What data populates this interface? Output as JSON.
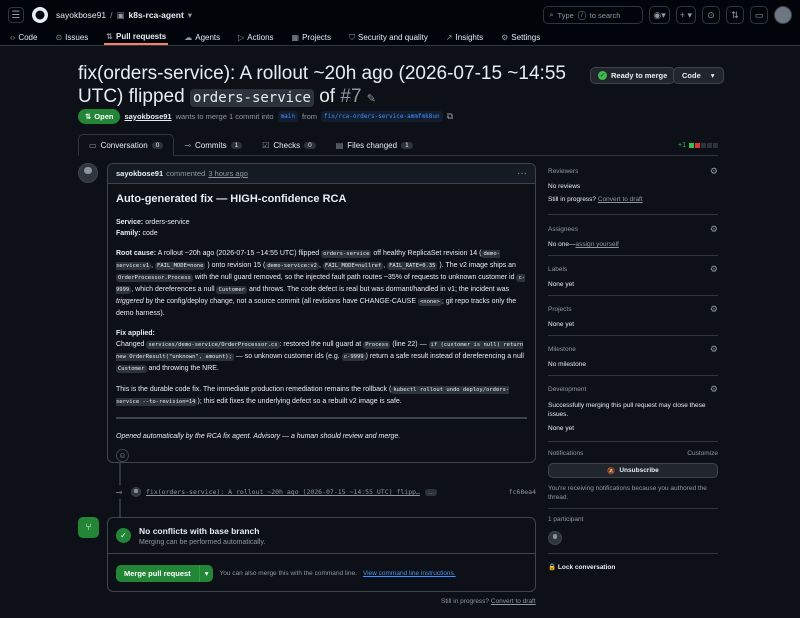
{
  "header": {
    "owner": "sayokbose91",
    "repo": "k8s-rca-agent",
    "search_placeholder": "Type / to search",
    "search_key": "/"
  },
  "nav_tabs": [
    {
      "label": "Code",
      "icon": "code-icon"
    },
    {
      "label": "Issues",
      "icon": "issue-icon"
    },
    {
      "label": "Pull requests",
      "icon": "pull-request-icon",
      "active": true
    },
    {
      "label": "Agents",
      "icon": "agent-icon"
    },
    {
      "label": "Actions",
      "icon": "play-icon"
    },
    {
      "label": "Projects",
      "icon": "table-icon"
    },
    {
      "label": "Security and quality",
      "icon": "shield-icon"
    },
    {
      "label": "Insights",
      "icon": "graph-icon"
    },
    {
      "label": "Settings",
      "icon": "gear-icon"
    }
  ],
  "pr": {
    "title_part1": "fix(orders-service): A rollout ~20h ago (2026-07-15 ~14:55 UTC) flipped",
    "title_code": "orders-service",
    "title_part2": "of",
    "number": "#7",
    "ready_label": "Ready to merge",
    "code_label": "Code",
    "state": "Open",
    "author": "sayokbose91",
    "merge_text": "wants to merge 1 commit into",
    "base": "main",
    "from_text": "from",
    "head": "fix/rca-orders-service-ammfmk8un"
  },
  "pr_tabs": [
    {
      "label": "Conversation",
      "count": "0",
      "icon": "comment-icon"
    },
    {
      "label": "Commits",
      "count": "1",
      "icon": "commit-icon"
    },
    {
      "label": "Checks",
      "count": "0",
      "icon": "checklist-icon"
    },
    {
      "label": "Files changed",
      "count": "1",
      "icon": "file-diff-icon"
    }
  ],
  "diffstat": {
    "added": "+1",
    "removed": "−1"
  },
  "comment": {
    "author": "sayokbose91",
    "action": "commented",
    "time": "3 hours ago",
    "heading": "Auto-generated fix — HIGH-confidence RCA",
    "service_label": "Service:",
    "service_value": "orders-service",
    "family_label": "Family:",
    "family_value": "code",
    "root_label": "Root cause:",
    "r1": "A rollout ~20h ago (2026-07-15 ~14:55 UTC) flipped",
    "rc1": "orders-service",
    "r2": "off healthy ReplicaSet revision 14 (",
    "rc2": "demo-service:v1",
    "r3": ",",
    "rc3": "FAIL_MODE=none",
    "r4": ") onto revision 15 (",
    "rc4": "demo-service:v2",
    "r5": ",",
    "rc5": "FAIL_MODE=nullref",
    "r6": ",",
    "rc6": "FAIL_RATE=0.35",
    "r7": "). The v2 image ships an",
    "rc7": "OrderProcessor.Process",
    "r8": "with the null guard removed, so the injected fault path routes ~35% of requests to unknown customer id",
    "rc8": "c-9999",
    "r9": ", which dereferences a null",
    "rc9": "Customer",
    "r10": "and throws. The code defect is real but was dormant/handled in v1; the incident was",
    "r10i": "triggered",
    "r11": "by the config/deploy change, not a source commit (all revisions have CHANGE-CAUSE",
    "rc11": "<none>",
    "r12": "; git repo tracks only the demo harness).",
    "fix_label": "Fix applied:",
    "f1": "Changed",
    "fc1": "services/demo-service/OrderProcessor.cs",
    "f2": ": restored the null guard at",
    "fc2": "Process",
    "f3": "(line 22) —",
    "fc3": "if (customer is null) return new OrderResult(\"unknown\", amount);",
    "f4": "— so unknown customer ids (e.g.",
    "fc4": "c-9999",
    "f5": ") return a safe result instead of dereferencing a null",
    "fc5": "Customer",
    "f6": "and throwing the NRE.",
    "d1": "This is the durable code fix. The immediate production remediation remains the rollback (",
    "dc1": "kubectl rollout undo deploy/orders-service --to-revision=14",
    "d2": "); this edit fixes the underlying defect so a rebuilt v2 image is safe.",
    "footer": "Opened automatically by the RCA fix agent. Advisory — a human should review and merge."
  },
  "commit": {
    "message": "fix(orders-service): A rollout ~20h ago (2026-07-15 ~14:55 UTC) flipp…",
    "ellipsis": "…",
    "sha": "fc68ea4"
  },
  "merge": {
    "title": "No conflicts with base branch",
    "subtitle": "Merging can be performed automatically.",
    "button": "Merge pull request",
    "hint": "You can also merge this with the command line.",
    "hint_link": "View command line instructions."
  },
  "still": {
    "text": "Still in progress?",
    "link": "Convert to draft"
  },
  "sidebar": {
    "reviewers": {
      "label": "Reviewers",
      "value": "No reviews",
      "still": "Still in progress?",
      "link": "Convert to draft"
    },
    "assignees": {
      "label": "Assignees",
      "value": "No one—",
      "link": "assign yourself"
    },
    "labels": {
      "label": "Labels",
      "value": "None yet"
    },
    "projects": {
      "label": "Projects",
      "value": "None yet"
    },
    "milestone": {
      "label": "Milestone",
      "value": "No milestone"
    },
    "development": {
      "label": "Development",
      "text": "Successfully merging this pull request may close these issues.",
      "value": "None yet"
    },
    "notifications": {
      "label": "Notifications",
      "customize": "Customize",
      "button": "Unsubscribe",
      "note": "You're receiving notifications because you authored the thread."
    },
    "participants": {
      "label": "1 participant"
    },
    "lock": "Lock conversation"
  },
  "colors": {
    "accent": "#238636",
    "link": "#4493f8",
    "bg": "#0d1117",
    "active_tab": "#f78166"
  }
}
